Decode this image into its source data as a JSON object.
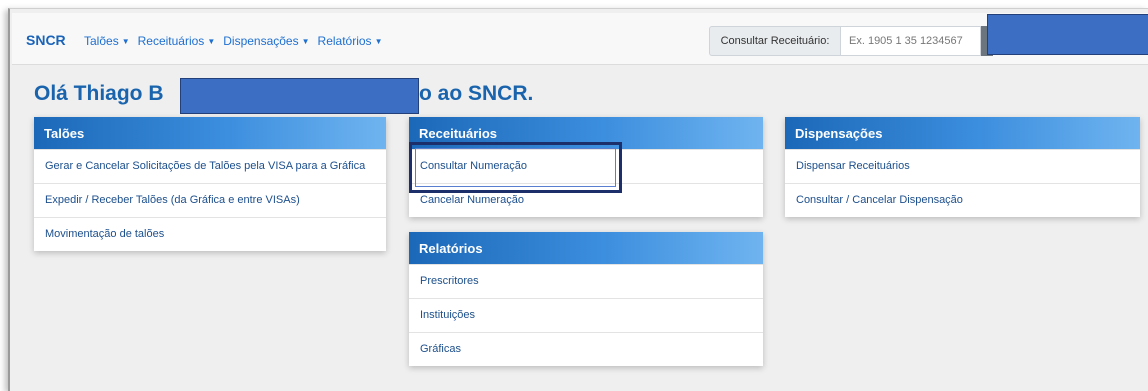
{
  "navbar": {
    "brand": "SNCR",
    "menu": [
      {
        "label": "Talões"
      },
      {
        "label": "Receituários"
      },
      {
        "label": "Dispensações"
      },
      {
        "label": "Relatórios"
      }
    ],
    "search_label": "Consultar Receituário:",
    "search_placeholder": "Ex. 1905 1 35 1234567"
  },
  "greeting": {
    "start": "Olá Thiago B",
    "end": "o ao SNCR."
  },
  "panels": {
    "taloes": {
      "title": "Talões",
      "items": [
        "Gerar e Cancelar Solicitações de Talões pela VISA para a Gráfica",
        "Expedir / Receber Talões (da Gráfica e entre VISAs)",
        "Movimentação de talões"
      ]
    },
    "receituarios": {
      "title": "Receituários",
      "items": [
        "Consultar Numeração",
        "Cancelar Numeração"
      ]
    },
    "relatorios": {
      "title": "Relatórios",
      "items": [
        "Prescritores",
        "Instituições",
        "Gráficas"
      ]
    },
    "dispensacoes": {
      "title": "Dispensações",
      "items": [
        "Dispensar Receituários",
        "Consultar / Cancelar Dispensação"
      ]
    }
  },
  "colors": {
    "brand": "#1a63b8",
    "panel_header_start": "#1c68b8",
    "panel_header_end": "#6fb4f0",
    "redaction": "#3c6ec4",
    "highlight_border": "#1d2f6b"
  }
}
